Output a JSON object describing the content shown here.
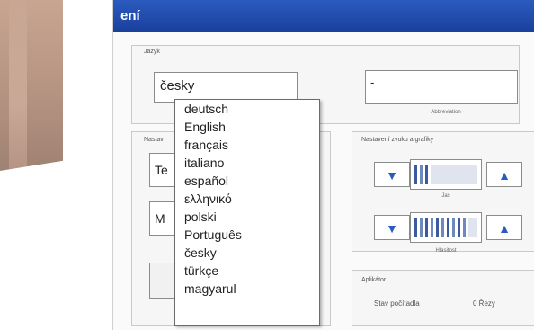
{
  "window": {
    "title": "ení"
  },
  "language": {
    "legend": "Jazyk",
    "current_value": "česky",
    "options": [
      "deutsch",
      "English",
      "français",
      "italiano",
      "español",
      "ελληνικό",
      "polski",
      "Português",
      "česky",
      "türkçe",
      "magyarul"
    ]
  },
  "abbr": {
    "value": "-",
    "caption": "Abbreviation"
  },
  "nastav_left": {
    "legend": "Nastav",
    "field1_value": "Te",
    "field2_value": "M"
  },
  "sound": {
    "legend": "Nastavení zvuku a grafiky",
    "volume_caption": "Jas",
    "contrast_caption": "Hlasitost",
    "volume_level": 0.25,
    "contrast_level": 0.85,
    "down_symbol": "▼",
    "up_symbol": "▲"
  },
  "applicator": {
    "legend": "Aplikátor",
    "counter_label": "Stav počítadla",
    "counter_value": "0 Řezy"
  },
  "colors": {
    "title_bar": "#1a3f9c",
    "accent": "#2b5bbf"
  }
}
